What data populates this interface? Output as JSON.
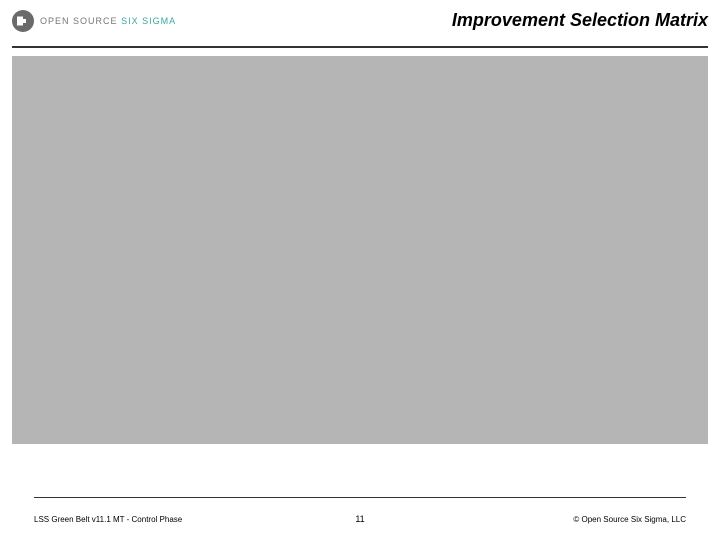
{
  "header": {
    "brand_open": "OPEN",
    "brand_source": "SOURCE",
    "brand_six": "SIX",
    "brand_sigma": "SIGMA",
    "slide_title": "Improvement Selection Matrix"
  },
  "footer": {
    "left": "LSS Green Belt v11.1 MT - Control Phase",
    "page_number": "11",
    "right": "©  Open Source Six Sigma, LLC"
  }
}
